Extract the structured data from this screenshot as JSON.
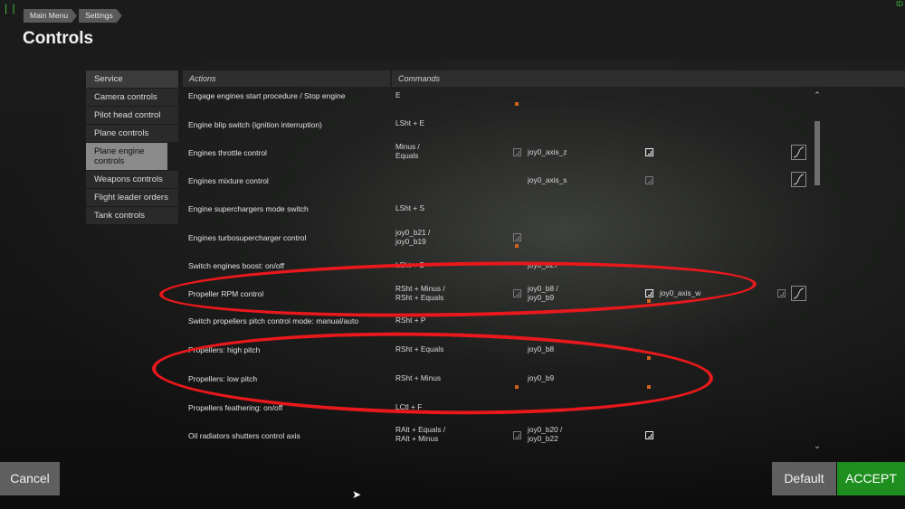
{
  "breadcrumb": [
    "Main Menu",
    "Settings"
  ],
  "title": "Controls",
  "sidebar": [
    "Service",
    "Camera controls",
    "Pilot head control",
    "Plane controls",
    "Plane engine controls",
    "Weapons controls",
    "Flight leader orders",
    "Tank controls"
  ],
  "sidebar_active": "Plane engine controls",
  "table": {
    "headers": {
      "actions": "Actions",
      "commands": "Commands"
    },
    "rows": [
      {
        "action": "Engage engines start procedure / Stop engine",
        "c1": "E",
        "c2": "",
        "c3": ""
      },
      {
        "action": "Engine blip switch (ignition interruption)",
        "c1": "LSht + E",
        "c2": "",
        "c3": ""
      },
      {
        "action": "Engines throttle control",
        "c1": "Minus / Equals",
        "c2": "joy0_axis_z",
        "c3": ""
      },
      {
        "action": "Engines mixture control",
        "c1": "",
        "c2": "joy0_axis_s",
        "c3": ""
      },
      {
        "action": "Engine superchargers mode switch",
        "c1": "LSht + S",
        "c2": "",
        "c3": ""
      },
      {
        "action": "Engines turbosupercharger control",
        "c1": "joy0_b21 / joy0_b19",
        "c2": "",
        "c3": ""
      },
      {
        "action": "Switch engines boost: on/off",
        "c1": "LSht + B",
        "c2": "joy0_b27",
        "c3": ""
      },
      {
        "action": "Propeller RPM control",
        "c1": "RSht + Minus / RSht + Equals",
        "c2": "joy0_b8 / joy0_b9",
        "c3": "joy0_axis_w"
      },
      {
        "action": "Switch propellers pitch control mode: manual/auto",
        "c1": "RSht + P",
        "c2": "",
        "c3": ""
      },
      {
        "action": "Propellers: high pitch",
        "c1": "RSht + Equals",
        "c2": "joy0_b8",
        "c3": ""
      },
      {
        "action": "Propellers: low pitch",
        "c1": "RSht + Minus",
        "c2": "joy0_b9",
        "c3": ""
      },
      {
        "action": "Propellers feathering: on/off",
        "c1": "LCtl + F",
        "c2": "",
        "c3": ""
      },
      {
        "action": "Oil radiators shutters control axis",
        "c1": "RAlt + Equals / RAlt + Minus",
        "c2": "joy0_b20 / joy0_b22",
        "c3": ""
      }
    ]
  },
  "buttons": {
    "cancel": "Cancel",
    "default": "Default",
    "accept": "ACCEPT"
  },
  "colors": {
    "accent": "#1e8f1e",
    "highlight": "#e8181c",
    "active_item": "#8a8a8a"
  }
}
